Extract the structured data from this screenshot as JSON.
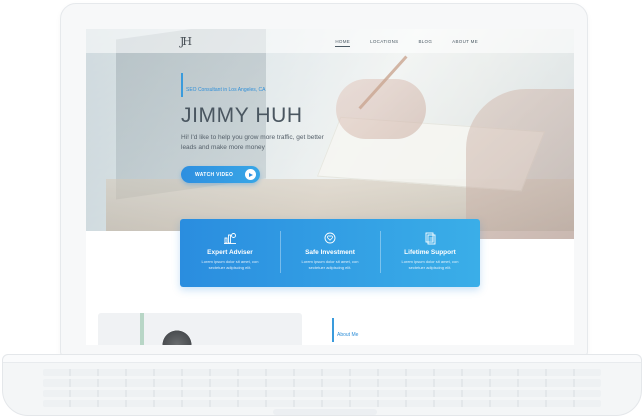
{
  "nav": {
    "logo": "JH",
    "items": [
      {
        "label": "HOME",
        "active": true
      },
      {
        "label": "LOCATIONS",
        "active": false
      },
      {
        "label": "BLOG",
        "active": false
      },
      {
        "label": "ABOUT ME",
        "active": false
      }
    ]
  },
  "hero": {
    "tagline": "SEO Consultant in Los Angeles, CA",
    "title": "JIMMY HUH",
    "description": "Hi! I'd like to help you grow more traffic, get better leads and make more money",
    "watch_button": "WATCH VIDEO"
  },
  "features": [
    {
      "icon": "chart-icon",
      "title": "Expert Adviser",
      "text": "Lorem ipsum dolor sit amet, con sectetuer adipiscing elit."
    },
    {
      "icon": "shield-heart-icon",
      "title": "Safe Investment",
      "text": "Lorem ipsum dolor sit amet, con sectetuer adipiscing elit."
    },
    {
      "icon": "document-icon",
      "title": "Lifetime Support",
      "text": "Lorem ipsum dolor sit amet, con sectetuer adipiscing elit."
    }
  ],
  "about": {
    "label": "About Me"
  },
  "colors": {
    "accent": "#2e8fe0",
    "accent_light": "#3aaee8",
    "text_dark": "#4a5660"
  }
}
